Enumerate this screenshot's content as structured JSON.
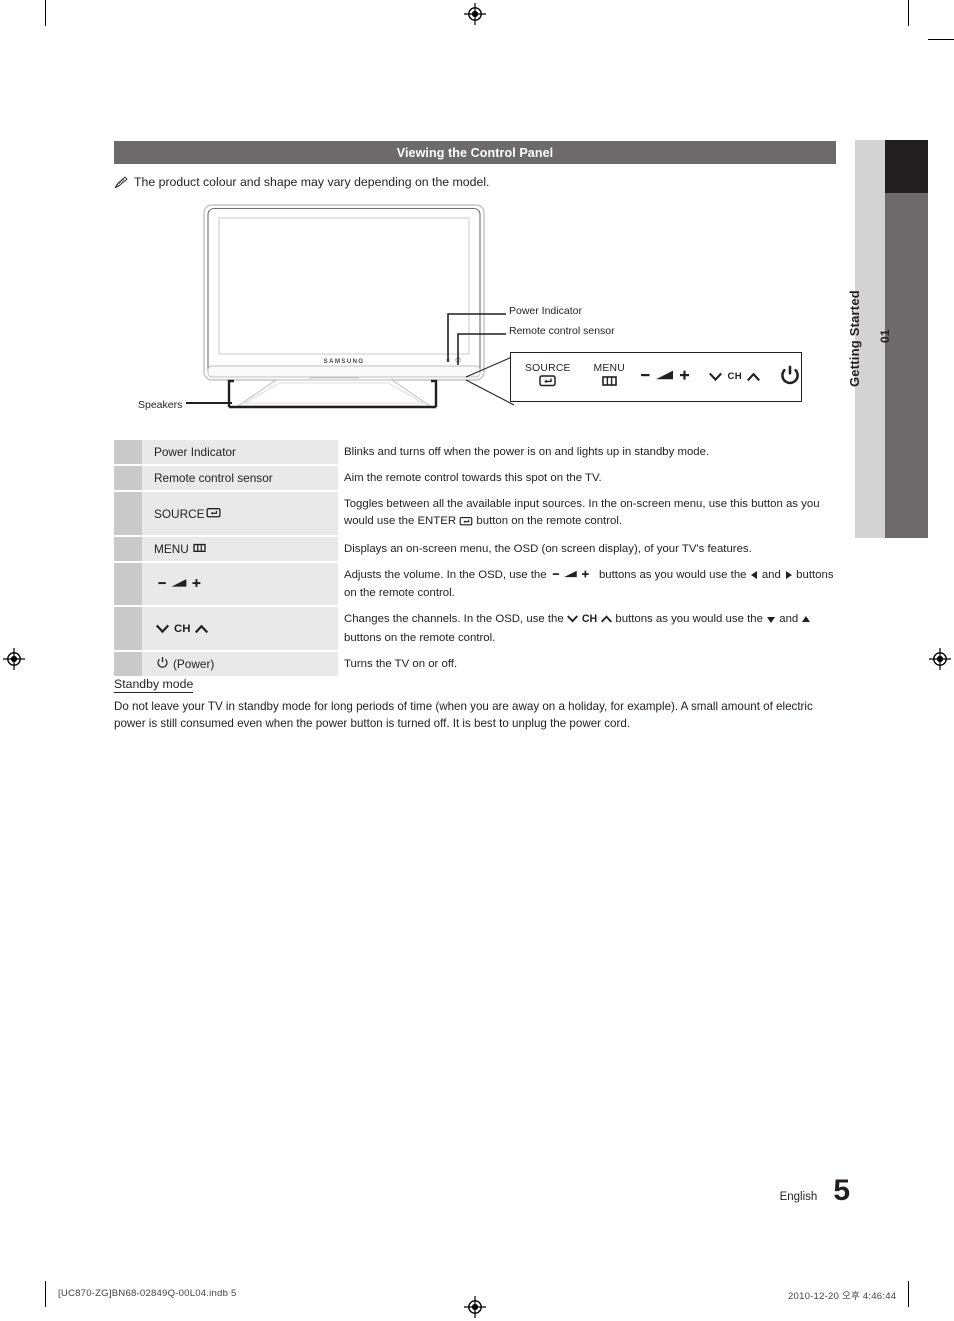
{
  "page": {
    "section_title": "Viewing the Control Panel",
    "note": "The product colour and shape may vary depending on the model.",
    "note_icon": "pencil-note-icon",
    "chapter_number": "01",
    "chapter_title": "Getting Started",
    "language": "English",
    "page_number": "5",
    "colors": {
      "header_bar": "#6d6a6b",
      "chapter_tab": "#d3d3d3",
      "chapter_bar_dark": "#221f20",
      "chapter_bar_gray": "#6d6a6b",
      "row_swatch": "#c9c9c9",
      "row_label": "#e9e9e9",
      "text": "#231f20"
    }
  },
  "figure": {
    "brand_logo": "SAMSUNG",
    "callouts": [
      {
        "id": "power-indicator",
        "label": "Power Indicator"
      },
      {
        "id": "remote-control-sensor",
        "label": "Remote control sensor"
      },
      {
        "id": "speakers",
        "label": "Speakers"
      }
    ]
  },
  "control_panel": {
    "buttons": [
      {
        "name": "source-button",
        "label": "SOURCE",
        "icon": "enter-return-icon"
      },
      {
        "name": "menu-button",
        "label": "MENU",
        "icon": "menu-bars-icon"
      },
      {
        "name": "volume-button",
        "label": "",
        "icon": "volume-minus-plus-icon"
      },
      {
        "name": "channel-button",
        "label": "CH",
        "icon": "channel-down-up-icon"
      },
      {
        "name": "power-button",
        "label": "",
        "icon": "power-icon"
      }
    ]
  },
  "table": {
    "rows": [
      {
        "name": "Power Indicator",
        "icon": "",
        "desc_parts": [
          {
            "t": "text",
            "v": "Blinks and turns off when the power is on and lights up in standby mode."
          }
        ],
        "tall": false
      },
      {
        "name": "Remote control sensor",
        "icon": "",
        "desc_parts": [
          {
            "t": "text",
            "v": "Aim the remote control towards this spot on the TV."
          }
        ],
        "tall": false
      },
      {
        "name": "SOURCE",
        "icon": "enter-return-icon",
        "desc_parts": [
          {
            "t": "text",
            "v": "Toggles between all the available input sources. In the on-screen menu, use this button as you would use the ENTER "
          },
          {
            "t": "icon",
            "v": "enter-return-icon"
          },
          {
            "t": "text",
            "v": " button on the remote control."
          }
        ],
        "tall": true
      },
      {
        "name": "MENU",
        "icon": "menu-bars-icon",
        "desc_parts": [
          {
            "t": "text",
            "v": "Displays an on-screen menu, the OSD (on screen display), of your TV's features."
          }
        ],
        "tall": false
      },
      {
        "name": "",
        "icon": "volume-minus-plus-icon",
        "desc_parts": [
          {
            "t": "text",
            "v": "Adjusts the volume. In the OSD, use the "
          },
          {
            "t": "icon",
            "v": "volume-minus-plus-icon"
          },
          {
            "t": "text",
            "v": " buttons as you would use the "
          },
          {
            "t": "icon",
            "v": "arrow-left-icon"
          },
          {
            "t": "text",
            "v": " and "
          },
          {
            "t": "icon",
            "v": "arrow-right-icon"
          },
          {
            "t": "text",
            "v": " buttons on the remote control."
          }
        ],
        "tall": true
      },
      {
        "name": "CH",
        "icon": "channel-down-up-icon",
        "desc_parts": [
          {
            "t": "text",
            "v": "Changes the channels. In the OSD, use the "
          },
          {
            "t": "icon",
            "v": "channel-down-up-icon"
          },
          {
            "t": "text",
            "v": " buttons as you would use the "
          },
          {
            "t": "icon",
            "v": "arrow-down-icon"
          },
          {
            "t": "text",
            "v": " and "
          },
          {
            "t": "icon",
            "v": "arrow-up-icon"
          },
          {
            "t": "text",
            "v": " buttons on the remote control."
          }
        ],
        "tall": true
      },
      {
        "name": "(Power)",
        "icon": "power-icon",
        "desc_parts": [
          {
            "t": "text",
            "v": "Turns the TV on or off."
          }
        ],
        "tall": false
      }
    ]
  },
  "standby": {
    "heading": "Standby mode",
    "body": "Do not leave your TV in standby mode for long periods of time (when you are away on a holiday, for example). A small amount of electric power is still consumed even when the power button is turned off. It is best to unplug the power cord."
  },
  "print_footer": {
    "left": "[UC870-ZG]BN68-02849Q-00L04.indb   5",
    "right": "2010-12-20   오후 4:46:44"
  }
}
